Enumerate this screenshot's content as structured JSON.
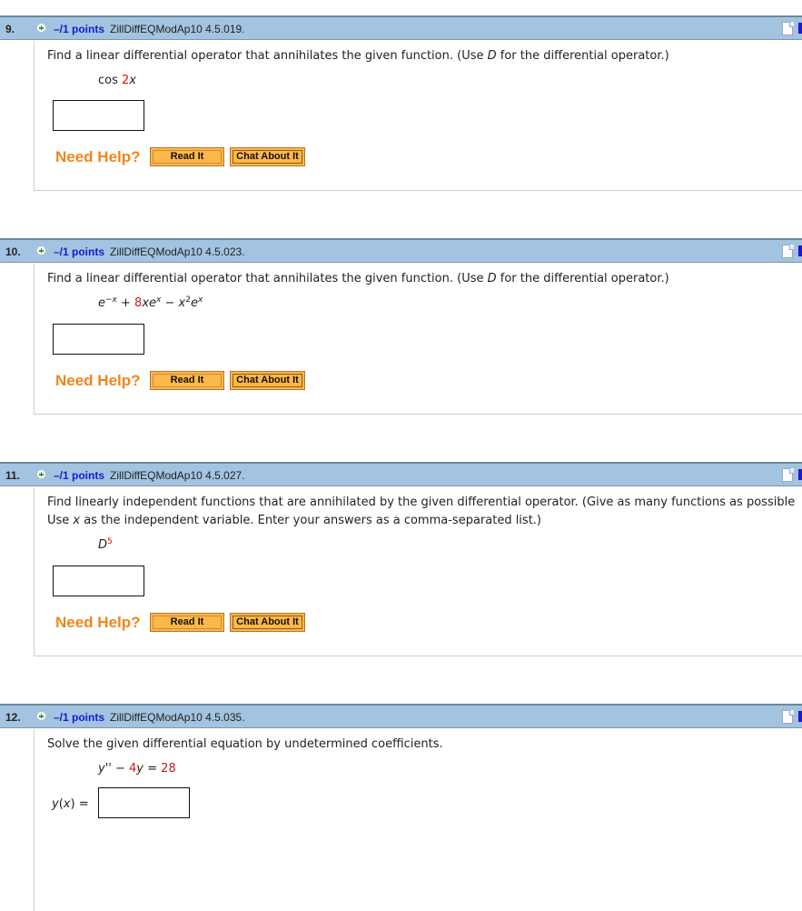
{
  "questions": [
    {
      "number": "9.",
      "points": "–/1 points",
      "code": "ZillDiffEQModAp10 4.5.019.",
      "prompt": "Find a linear differential operator that annihilates the given function. (Use D for the differential operator.)",
      "prompt_parts": {
        "before": "Find a linear differential operator that annihilates the given function. (Use ",
        "var": "D",
        "after": " for the differential operator.)"
      },
      "math": {
        "func": "cos ",
        "coef": "2",
        "var": "x"
      },
      "answer_value": "",
      "need_help": "Need Help?",
      "read_it": "Read It",
      "chat_about_it": "Chat About It"
    },
    {
      "number": "10.",
      "points": "–/1 points",
      "code": "ZillDiffEQModAp10 4.5.023.",
      "prompt": "Find a linear differential operator that annihilates the given function. (Use D for the differential operator.)",
      "prompt_parts": {
        "before": "Find a linear differential operator that annihilates the given function. (Use ",
        "var": "D",
        "after": " for the differential operator.)"
      },
      "math": {
        "t1_base": "e",
        "t1_exp": "−x",
        "plus": " + ",
        "coef": "8",
        "t2": "xe",
        "t2_exp": "x",
        "minus": " − ",
        "t3_base": "x",
        "t3_exp": "2",
        "t3_e": "e",
        "t3_e_exp": "x"
      },
      "answer_value": "",
      "need_help": "Need Help?",
      "read_it": "Read It",
      "chat_about_it": "Chat About It"
    },
    {
      "number": "11.",
      "points": "–/1 points",
      "code": "ZillDiffEQModAp10 4.5.027.",
      "prompt_line1": "Find linearly independent functions that are annihilated by the given differential operator. (Give as many functions as possible",
      "prompt_line2_parts": {
        "before": "Use ",
        "var": "x",
        "after": " as the independent variable. Enter your answers as a comma-separated list.)"
      },
      "math": {
        "base": "D",
        "exp": "5"
      },
      "answer_value": "",
      "need_help": "Need Help?",
      "read_it": "Read It",
      "chat_about_it": "Chat About It"
    },
    {
      "number": "12.",
      "points": "–/1 points",
      "code": "ZillDiffEQModAp10 4.5.035.",
      "prompt": "Solve the given differential equation by undetermined coefficients.",
      "math": {
        "lhs": "y''",
        "minus": " − ",
        "coef": "4",
        "var": "y",
        "eq": " = ",
        "rhs": "28"
      },
      "answer_label": {
        "func": "y",
        "open": "(",
        "var": "x",
        "close": ") = "
      },
      "answer_value": ""
    }
  ],
  "colors": {
    "header_bg": "#a2c4e0",
    "points_blue": "#1a1ad0",
    "need_help_orange": "#f0861a",
    "button_orange": "#fdb84a",
    "math_red": "#d01818"
  }
}
